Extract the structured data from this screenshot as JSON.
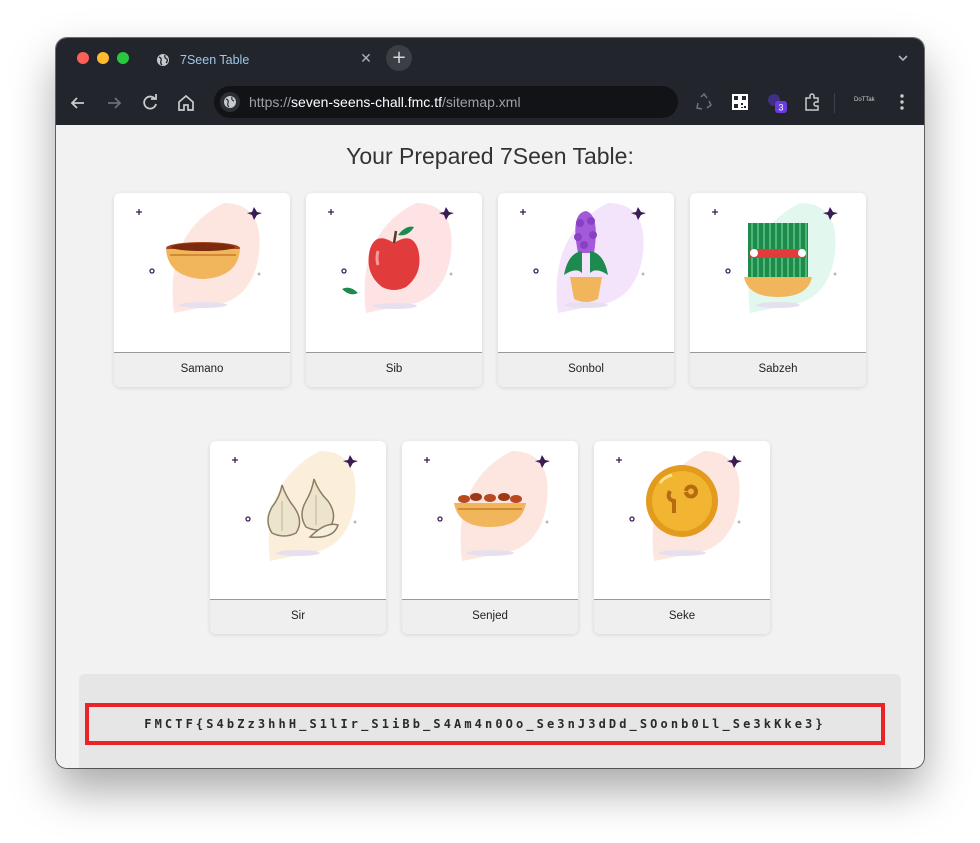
{
  "browser": {
    "tab_title": "7Seen Table",
    "tab_close": "✕",
    "new_tab": "+",
    "url_scheme": "https://",
    "url_host": "seven-seens-chall.fmc.tf",
    "url_path": "/sitemap.xml",
    "extension_badge": "3",
    "profile_label": "DoTTak",
    "icons": [
      "globe-icon",
      "back-arrow-icon",
      "forward-arrow-icon",
      "reload-icon",
      "home-icon",
      "site-info-icon",
      "recycle-icon",
      "qr-code-icon",
      "extension-badge-icon",
      "puzzle-icon",
      "kebab-menu-icon",
      "chevron-down-icon"
    ]
  },
  "page": {
    "heading": "Your Prepared 7Seen Table:",
    "items": [
      {
        "name": "Samano",
        "icon": "samanu-bowl-icon",
        "accent": "#f2c27a"
      },
      {
        "name": "Sib",
        "icon": "apple-icon",
        "accent": "#e23b3b"
      },
      {
        "name": "Sonbol",
        "icon": "hyacinth-icon",
        "accent": "#a35ad8"
      },
      {
        "name": "Sabzeh",
        "icon": "sprouts-icon",
        "accent": "#1f8a4a"
      },
      {
        "name": "Sir",
        "icon": "garlic-icon",
        "accent": "#e9e0c4"
      },
      {
        "name": "Senjed",
        "icon": "senjed-bowl-icon",
        "accent": "#b9491f"
      },
      {
        "name": "Seke",
        "icon": "coin-icon",
        "accent": "#f1b531"
      }
    ],
    "flag": "FMCTF{S4bZz3hhH_S1lIr_S1iBb_S4Am4n0Oo_Se3nJ3dDd_SOonb0Ll_Se3kKke3}"
  },
  "colors": {
    "chrome_bg": "#22252b",
    "page_bg": "#f2f2f2",
    "flag_border": "#e8242a"
  }
}
